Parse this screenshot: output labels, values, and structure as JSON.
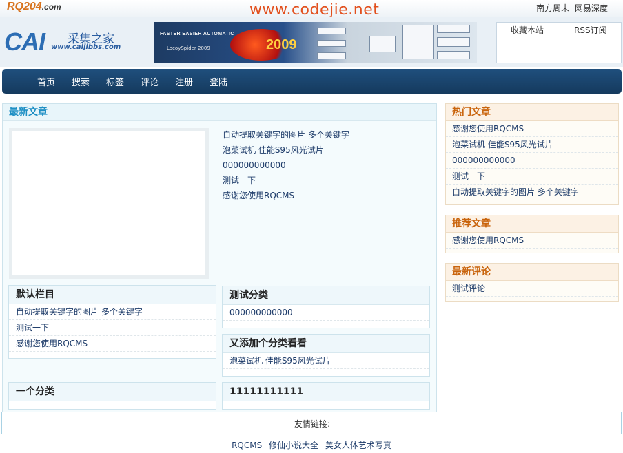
{
  "top": {
    "logo": "RQ204",
    "logo_domain": ".com",
    "watermark": "www.codejie.net",
    "links": [
      "南方周末",
      "网易深度"
    ]
  },
  "header": {
    "logo_text": "CAI",
    "logo_cn": "采集之家",
    "logo_url": "www.caijibbs.com",
    "banner_line1": "FASTER  EASIER  AUTOMATIC",
    "banner_line2": "LocoySpider 2009",
    "banner_year": "2009",
    "bookmark_label": "收藏本站",
    "rss_label": "RSS订阅"
  },
  "nav": {
    "items": [
      "首页",
      "搜索",
      "标签",
      "评论",
      "注册",
      "登陆"
    ]
  },
  "main": {
    "latest_title": "最新文章",
    "latest_items": [
      "自动提取关键字的图片 多个关键字",
      "泡菜试机 佳能S95风光试片",
      "000000000000",
      "测试一下",
      "感谢您使用RQCMS"
    ],
    "categories": [
      {
        "title": "默认栏目",
        "items": [
          "自动提取关键字的图片 多个关键字",
          "测试一下",
          "感谢您使用RQCMS"
        ]
      },
      {
        "title": "测试分类",
        "items": [
          "000000000000"
        ]
      },
      {
        "title": "又添加个分类看看",
        "items": [
          "泡菜试机 佳能S95风光试片"
        ]
      },
      {
        "title": "一个分类",
        "items": []
      },
      {
        "title": "11111111111",
        "items": []
      }
    ]
  },
  "sidebar": {
    "hot_title": "热门文章",
    "hot_items": [
      "感谢您使用RQCMS",
      "泡菜试机 佳能S95风光试片",
      "000000000000",
      "测试一下",
      "自动提取关键字的图片 多个关键字"
    ],
    "rec_title": "推荐文章",
    "rec_items": [
      "感谢您使用RQCMS"
    ],
    "comments_title": "最新评论",
    "comments_items": [
      "测试评论"
    ]
  },
  "footer": {
    "friend_links_label": "友情链接:",
    "links": [
      "RQCMS",
      "修仙小说大全",
      "美女人体艺术写真"
    ]
  },
  "colors": {
    "nav_bg": "#1b4571",
    "link": "#1e3c6a",
    "title_blue": "#1e8fc4",
    "title_orange": "#c9640c",
    "watermark": "#e2501e"
  }
}
